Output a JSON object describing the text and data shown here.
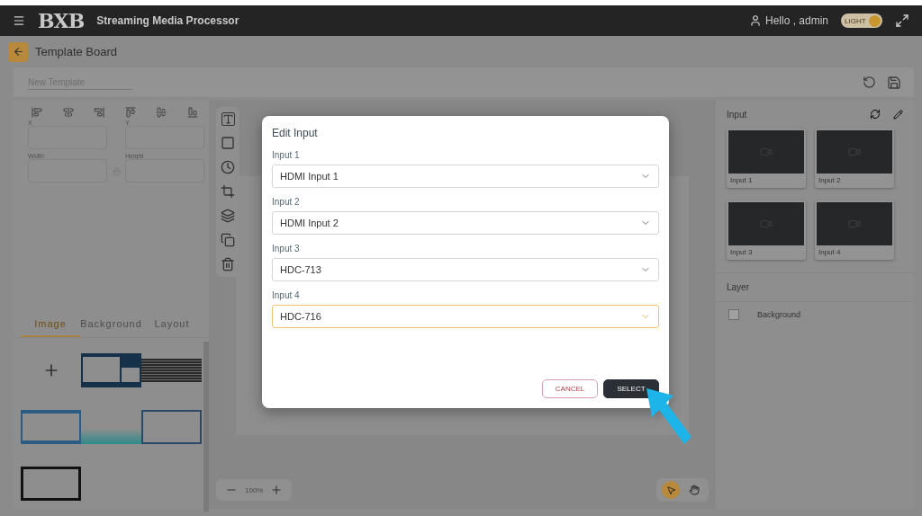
{
  "header": {
    "logo": "BXB",
    "title": "Streaming Media Processor",
    "greeting": "Hello , admin",
    "theme_toggle": {
      "label": "LIGHT",
      "on": true
    }
  },
  "page_title": "Template Board",
  "template_name": {
    "placeholder": "New Template"
  },
  "properties": {
    "fields": [
      {
        "label": "X"
      },
      {
        "label": "Y"
      },
      {
        "label": "Width"
      },
      {
        "label": "Height"
      }
    ]
  },
  "tabs": [
    {
      "label": "Image",
      "selected": true
    },
    {
      "label": "Background",
      "selected": false
    },
    {
      "label": "Layout",
      "selected": false
    }
  ],
  "zoom": "100%",
  "tool_modes": [
    {
      "kind": "pointer",
      "selected": true
    },
    {
      "kind": "hand",
      "selected": false
    }
  ],
  "input_panel": {
    "title": "Input",
    "inputs": [
      {
        "label": "Input 1"
      },
      {
        "label": "Input 2"
      },
      {
        "label": "Input 3"
      },
      {
        "label": "Input 4"
      }
    ]
  },
  "layer_panel": {
    "title": "Layer",
    "layers": [
      {
        "label": "Background",
        "checked": false
      }
    ]
  },
  "dialog": {
    "title": "Edit Input",
    "fields": [
      {
        "label": "Input 1",
        "value": "HDMI Input 1",
        "focused": false
      },
      {
        "label": "Input 2",
        "value": "HDMI Input 2",
        "focused": false
      },
      {
        "label": "Input 3",
        "value": "HDC-713",
        "focused": false
      },
      {
        "label": "Input 4",
        "value": "HDC-716",
        "focused": true
      }
    ],
    "buttons": [
      {
        "kind": "secondary",
        "label": "CANCEL"
      },
      {
        "kind": "primary",
        "label": "SELECT"
      }
    ]
  }
}
